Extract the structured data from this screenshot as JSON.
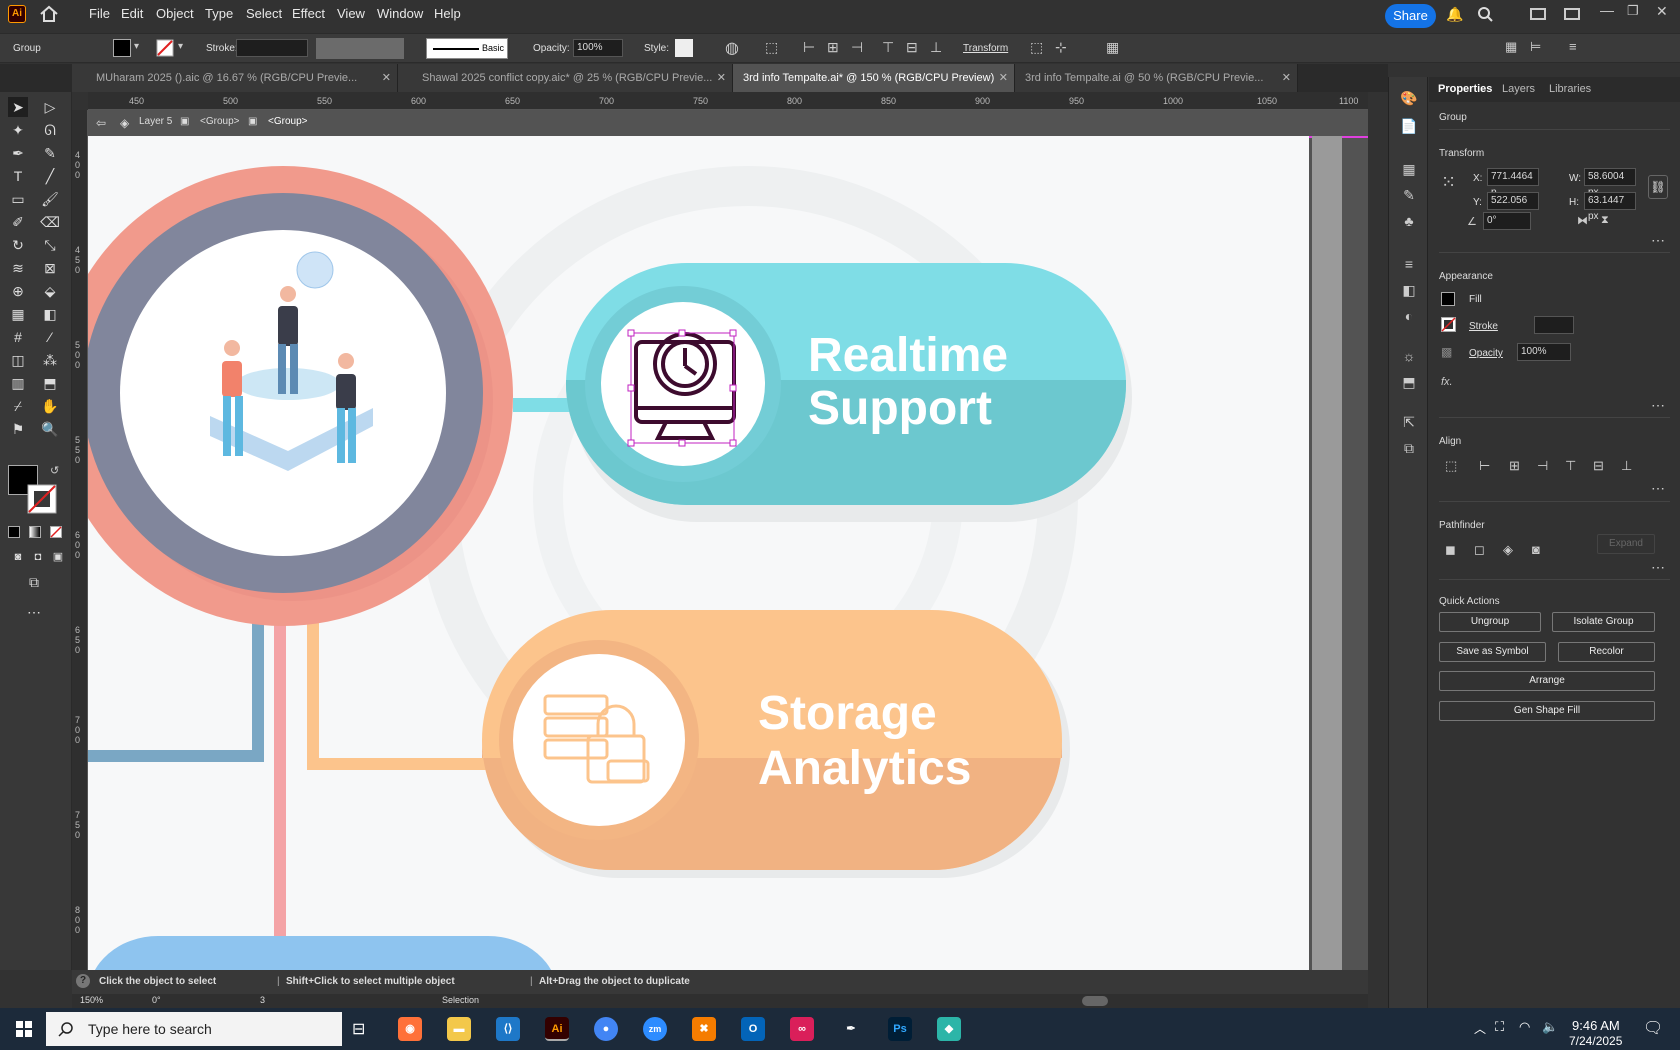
{
  "app": {
    "logo": "Ai",
    "share_label": "Share"
  },
  "menu": [
    "File",
    "Edit",
    "Object",
    "Type",
    "Select",
    "Effect",
    "View",
    "Window",
    "Help"
  ],
  "control": {
    "selection_type": "Group",
    "stroke_label": "Stroke:",
    "brush": "Basic",
    "opacity_label": "Opacity:",
    "opacity_value": "100%",
    "style_label": "Style:",
    "transform_label": "Transform"
  },
  "tabs": [
    {
      "label": "MUharam 2025 ().aic @ 16.67 % (RGB/CPU Previe...",
      "active": false
    },
    {
      "label": "Shawal 2025 conflict copy.aic* @ 25 % (RGB/CPU Previe...",
      "active": false
    },
    {
      "label": "3rd info Tempalte.ai* @ 150 % (RGB/CPU Preview)",
      "active": true
    },
    {
      "label": "3rd info Tempalte.ai @ 50 % (RGB/CPU Previe...",
      "active": false
    }
  ],
  "ruler_ticks": [
    "450",
    "500",
    "550",
    "600",
    "650",
    "700",
    "750",
    "800",
    "850",
    "900",
    "950",
    "1000",
    "1050",
    "1100"
  ],
  "vruler_ticks": [
    "4 0 0",
    "4 5 0",
    "5 0 0",
    "5 5 0",
    "6 0 0",
    "6 5 0",
    "7 0 0",
    "7 5 0",
    "8 0 0"
  ],
  "breadcrumb": {
    "layer": "Layer 5",
    "group1": "<Group>",
    "group2": "<Group>"
  },
  "artwork": {
    "card1": {
      "line1": "Realtime",
      "line2": "Support",
      "color_light": "#7fdde6",
      "color_dark": "#6cc8cf"
    },
    "card2": {
      "line1": "Storage",
      "line2": "Analytics",
      "color_light": "#fcc48c",
      "color_dark": "#f1b282"
    },
    "ring_outer": "#f19a8c",
    "ring_inner": "#81869c"
  },
  "status": {
    "hint_1": "Click the object to select",
    "hint_2": "Shift+Click to select multiple object",
    "hint_3": "Alt+Drag the object to duplicate"
  },
  "bottom": {
    "zoom": "150%",
    "rotate": "0°",
    "artboard": "3",
    "tool": "Selection"
  },
  "panel": {
    "tabs": [
      "Properties",
      "Layers",
      "Libraries"
    ],
    "selection": "Group",
    "transform_title": "Transform",
    "x_label": "X:",
    "x": "771.4464 p",
    "y_label": "Y:",
    "y": "522.056 px",
    "w_label": "W:",
    "w": "58.6004 px",
    "h_label": "H:",
    "h": "63.1447 px",
    "angle": "0°",
    "appearance_title": "Appearance",
    "fill_label": "Fill",
    "stroke_label": "Stroke",
    "opacity_label": "Opacity",
    "opacity_value": "100%",
    "fx": "fx.",
    "align_title": "Align",
    "pathfinder_title": "Pathfinder",
    "expand_label": "Expand",
    "quick_title": "Quick Actions",
    "btn_ungroup": "Ungroup",
    "btn_isolate": "Isolate Group",
    "btn_symbol": "Save as Symbol",
    "btn_recolor": "Recolor",
    "btn_arrange": "Arrange",
    "btn_genshape": "Gen Shape Fill"
  },
  "taskbar": {
    "search_placeholder": "Type here to search",
    "time": "9:46 AM",
    "date": "7/24/2025"
  }
}
